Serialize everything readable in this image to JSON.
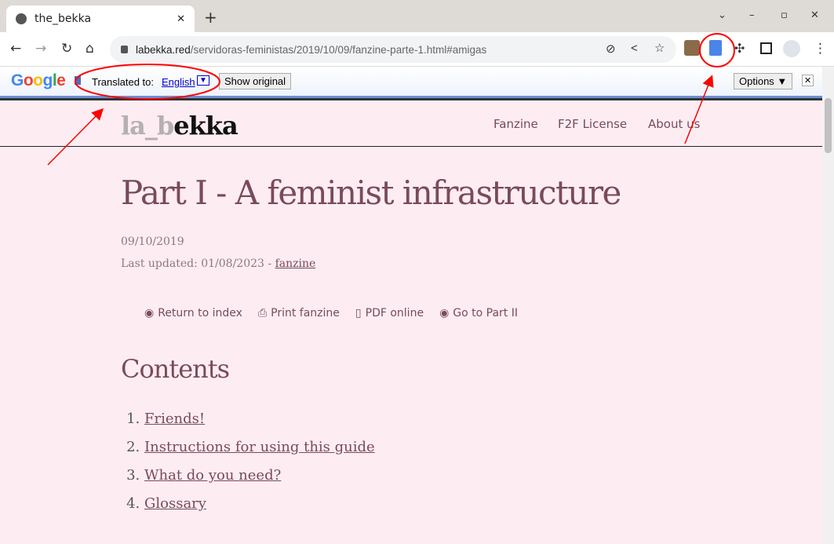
{
  "browser": {
    "tab_title": "the_bekka",
    "url_domain": "labekka.red",
    "url_path": "/servidoras-feministas/2019/10/09/fanzine-parte-1.html#amigas"
  },
  "translate_bar": {
    "logo": "Google",
    "translated_to_label": "Translated to:",
    "language": "English",
    "show_original": "Show original",
    "options": "Options ▼",
    "close": "✕"
  },
  "site": {
    "logo_gray": "la_b",
    "logo_dark": "ekka",
    "menu": [
      "Fanzine",
      "F2F License",
      "About us"
    ]
  },
  "article": {
    "title": "Part I - A feminist infrastructure",
    "date": "09/10/2019",
    "last_updated": "Last updated: 01/08/2023 - ",
    "category": "fanzine",
    "actions": [
      {
        "icon": "eye-icon",
        "label": "Return to index"
      },
      {
        "icon": "print-icon",
        "label": "Print fanzine"
      },
      {
        "icon": "file-icon",
        "label": "PDF online"
      },
      {
        "icon": "eye-icon",
        "label": "Go to Part II"
      }
    ],
    "contents_heading": "Contents",
    "contents": [
      "Friends!",
      "Instructions for using this guide",
      "What do you need?",
      "Glossary"
    ]
  },
  "annotation_color": "#ff0000"
}
